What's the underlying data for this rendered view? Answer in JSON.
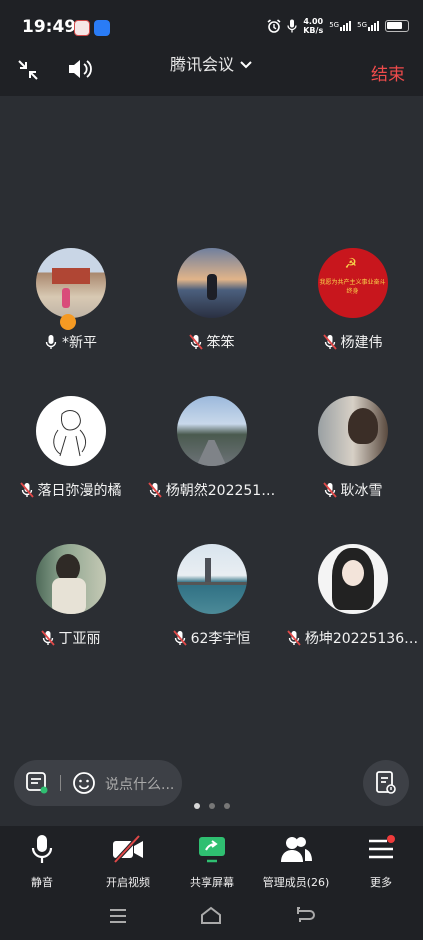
{
  "status_bar": {
    "time": "19:49",
    "net_speed": "4.00",
    "net_unit": "KB/s",
    "sim1": "5G",
    "sim2": "5G"
  },
  "topbar": {
    "title": "腾讯会议",
    "end_label": "结束"
  },
  "participants": [
    {
      "name": "*新平",
      "mic": "on",
      "host": true
    },
    {
      "name": "笨笨",
      "mic": "muted"
    },
    {
      "name": "杨建伟",
      "mic": "muted",
      "avatar_text": "我愿为共产主义事业奋斗终身"
    },
    {
      "name": "落日弥漫的橘",
      "mic": "muted"
    },
    {
      "name": "杨朝然202251…",
      "mic": "muted"
    },
    {
      "name": "耿冰雪",
      "mic": "muted"
    },
    {
      "name": "丁亚丽",
      "mic": "muted"
    },
    {
      "name": "62李宇恒",
      "mic": "muted"
    },
    {
      "name": "杨坤20225136…",
      "mic": "muted"
    }
  ],
  "chat": {
    "placeholder": "说点什么..."
  },
  "pager": {
    "pages": 3,
    "current": 1
  },
  "toolbar": {
    "mute": "静音",
    "video": "开启视频",
    "share": "共享屏幕",
    "members": "管理成员(26)",
    "more": "更多"
  },
  "colors": {
    "accent_end": "#ef4b4b",
    "share_green": "#2fbf71",
    "host_badge": "#f59a23"
  }
}
